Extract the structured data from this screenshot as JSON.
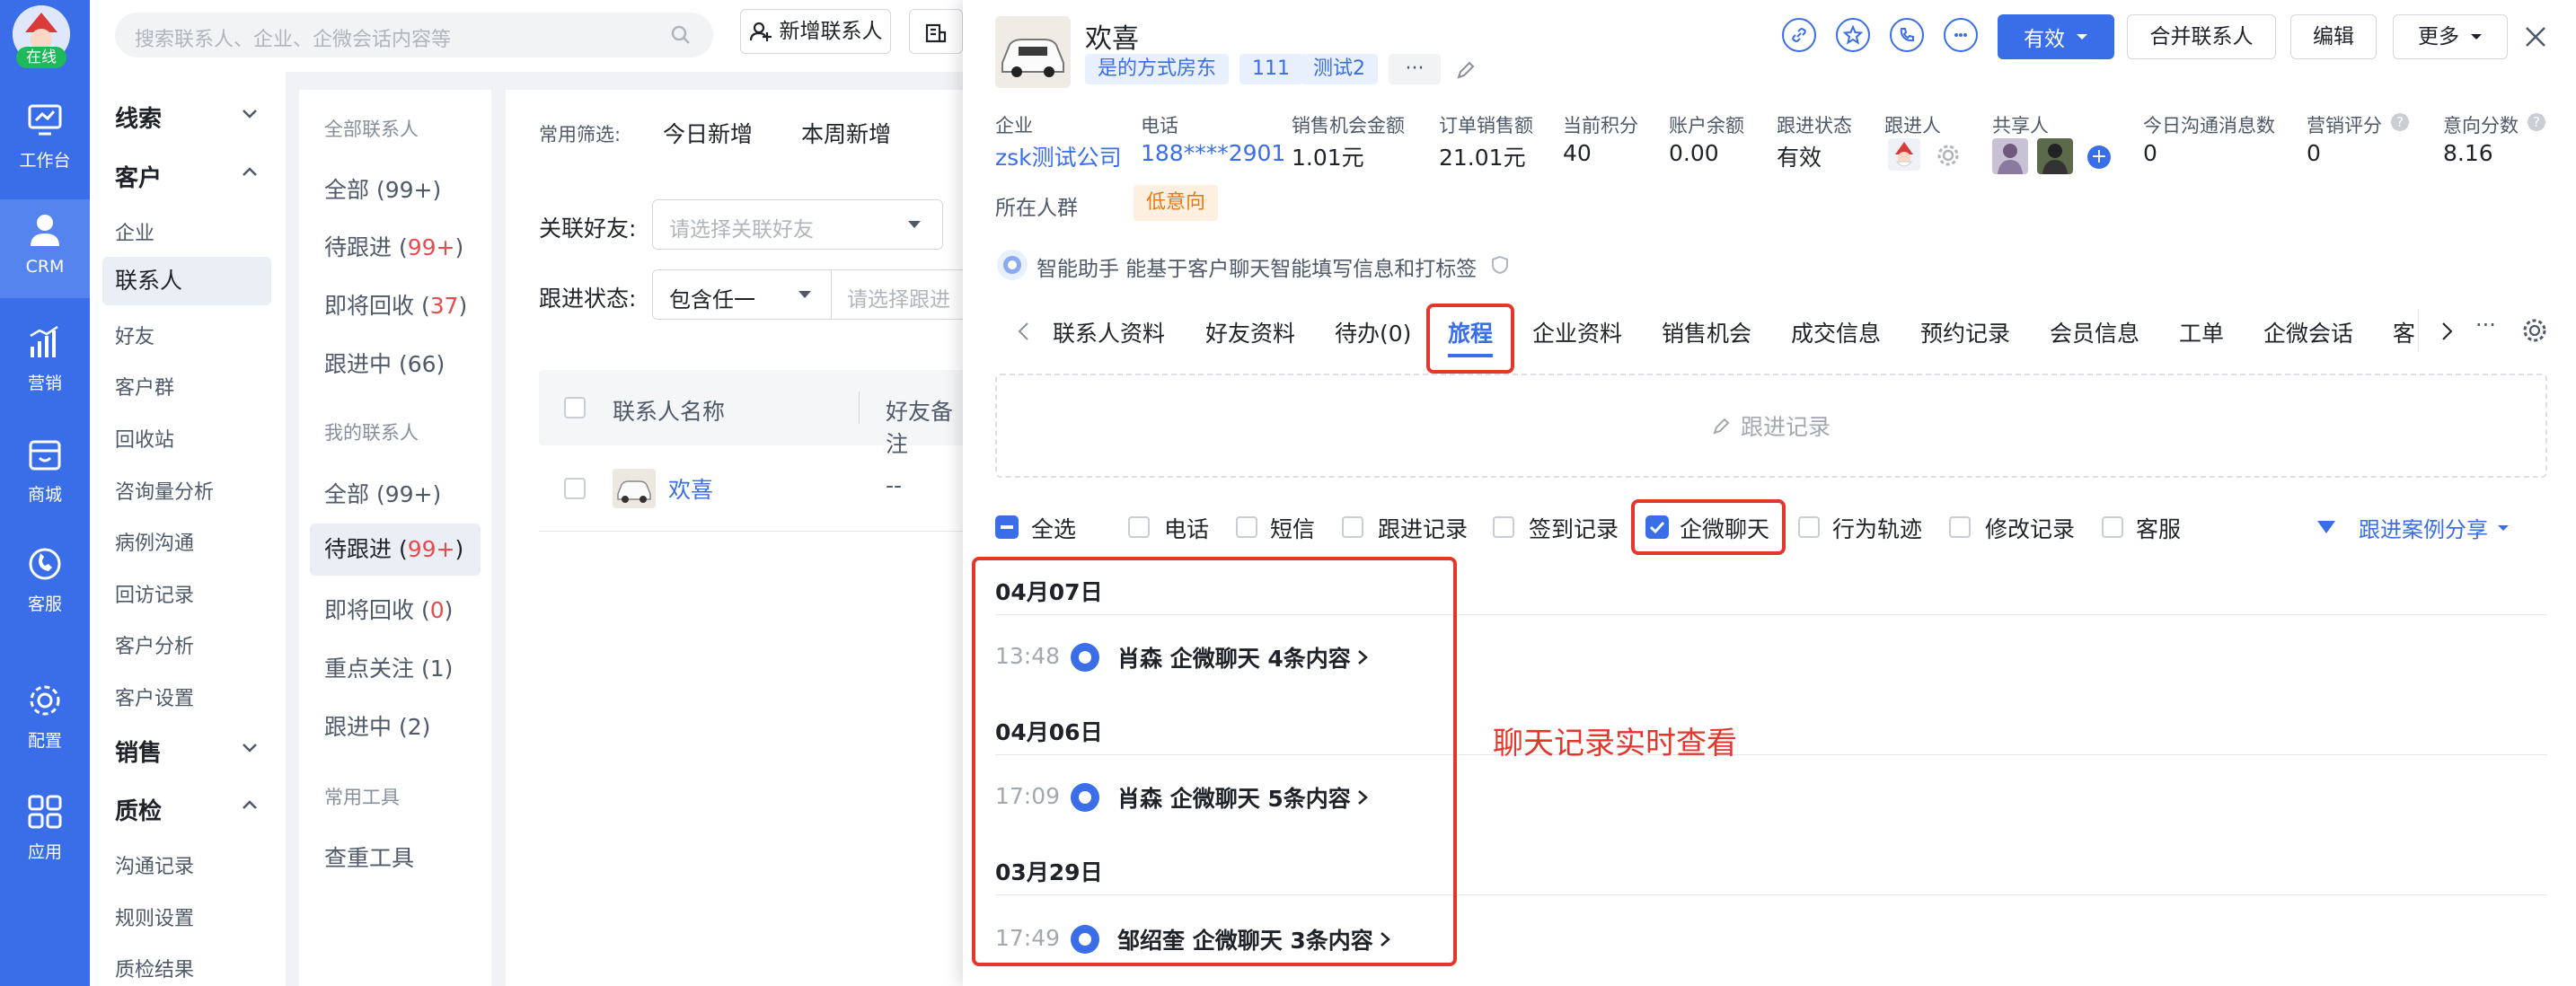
{
  "rail": {
    "status": "在线",
    "items": [
      "工作台",
      "CRM",
      "营销",
      "商城",
      "客服",
      "配置",
      "应用"
    ]
  },
  "subnav": {
    "groups": [
      {
        "title": "线索"
      },
      {
        "title": "客户",
        "items": [
          "企业",
          "联系人",
          "好友",
          "客户群",
          "回收站",
          "咨询量分析",
          "病例沟通",
          "回访记录",
          "客户分析",
          "客户设置"
        ]
      },
      {
        "title": "销售"
      },
      {
        "title": "质检",
        "items": [
          "沟通记录",
          "规则设置",
          "质检结果"
        ]
      }
    ]
  },
  "topbar": {
    "search_placeholder": "搜索联系人、企业、企微会话内容等",
    "add_contact": "新增联系人"
  },
  "groups": {
    "all_title": "全部联系人",
    "all": [
      {
        "label": "全部 (99+)"
      },
      {
        "label": "待跟进 (",
        "count": "99+",
        "tail": ")"
      },
      {
        "label": "即将回收 (",
        "count": "37",
        "tail": ")"
      },
      {
        "label": "跟进中 (66)"
      }
    ],
    "mine_title": "我的联系人",
    "mine": [
      {
        "label": "全部 (99+)"
      },
      {
        "label": "待跟进 (",
        "count": "99+",
        "tail": ")"
      },
      {
        "label": "即将回收 (",
        "count": "0",
        "tail": ")"
      },
      {
        "label": "重点关注 (1)"
      },
      {
        "label": "跟进中 (2)"
      }
    ],
    "tools_title": "常用工具",
    "tools": [
      "查重工具"
    ]
  },
  "filters": {
    "quick_label": "常用筛选:",
    "quick": [
      "今日新增",
      "本周新增"
    ],
    "friend_label": "关联好友:",
    "friend_placeholder": "请选择关联好友",
    "status_label": "跟进状态:",
    "status_mode": "包含任一",
    "status_placeholder": "请选择跟进",
    "col_name": "联系人名称",
    "col_remark": "好友备注",
    "row_name": "欢喜",
    "row_remark": "--"
  },
  "drawer": {
    "name": "欢喜",
    "tags": [
      "是的方式房东",
      "111",
      "测试2",
      "···"
    ],
    "status_btn": "有效",
    "merge_btn": "合并联系人",
    "edit_btn": "编辑",
    "more_btn": "更多",
    "fields": [
      {
        "label": "企业",
        "value": "zsk测试公司",
        "link": true
      },
      {
        "label": "电话",
        "value": "188****2901",
        "link": true
      },
      {
        "label": "销售机会金额",
        "value": "1.01元"
      },
      {
        "label": "订单销售额",
        "value": "21.01元"
      },
      {
        "label": "当前积分",
        "value": "40"
      },
      {
        "label": "账户余额",
        "value": "0.00"
      },
      {
        "label": "跟进状态",
        "value": "有效"
      },
      {
        "label": "跟进人",
        "value": ""
      },
      {
        "label": "共享人",
        "value": ""
      },
      {
        "label": "今日沟通消息数",
        "value": "0"
      },
      {
        "label": "营销评分",
        "value": "0"
      },
      {
        "label": "意向分数",
        "value": "8.16"
      }
    ],
    "crowd_label": "所在人群",
    "crowd_tag": "低意向",
    "assistant": "智能助手 能基于客户聊天智能填写信息和打标签",
    "tabs": [
      "联系人资料",
      "好友资料",
      "待办(0)",
      "旅程",
      "企业资料",
      "销售机会",
      "成交信息",
      "预约记录",
      "会员信息",
      "工单",
      "企微会话",
      "客"
    ],
    "active_tab": "旅程",
    "follow_record": "跟进记录",
    "checkboxes": [
      "全选",
      "电话",
      "短信",
      "跟进记录",
      "签到记录",
      "企微聊天",
      "行为轨迹",
      "修改记录",
      "客服"
    ],
    "share": "跟进案例分享",
    "timeline": [
      {
        "date": "04月07日",
        "time": "13:48",
        "text": "肖森 企微聊天  4条内容"
      },
      {
        "date": "04月06日",
        "time": "17:09",
        "text": "肖森 企微聊天  5条内容"
      },
      {
        "date": "03月29日",
        "time": "17:49",
        "text": "邹绍奎 企微聊天  3条内容"
      }
    ],
    "annotation": "聊天记录实时查看"
  },
  "colors": {
    "accent": "#3a6ee8",
    "alert": "#e5362c"
  }
}
